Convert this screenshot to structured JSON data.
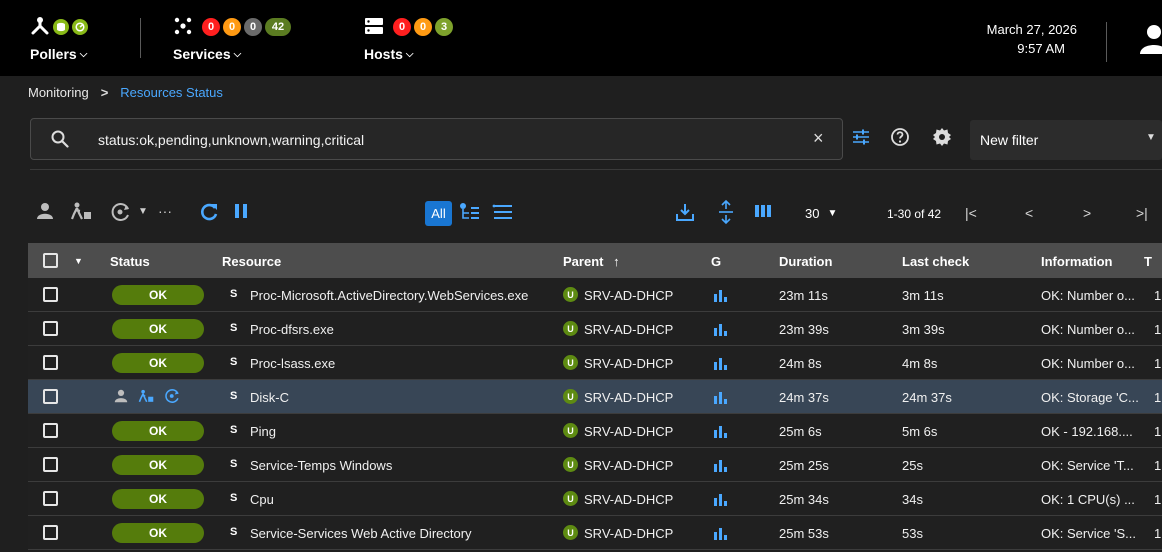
{
  "header": {
    "pollers": {
      "label": "Pollers"
    },
    "services": {
      "label": "Services",
      "counts": [
        "0",
        "0",
        "0",
        "42"
      ]
    },
    "hosts": {
      "label": "Hosts",
      "counts": [
        "0",
        "0",
        "3"
      ]
    },
    "date": "March 27, 2026",
    "time": "9:57 AM"
  },
  "breadcrumb": {
    "root": "Monitoring",
    "separator": ">",
    "current": "Resources Status"
  },
  "search": {
    "value": "status:ok,pending,unknown,warning,critical",
    "clear": "×"
  },
  "filter": {
    "selected": "New filter"
  },
  "toolbar": {
    "more": "···",
    "all_label": "All",
    "per_page": "30",
    "range": "1-30 of 42"
  },
  "table": {
    "headers": {
      "status": "Status",
      "resource": "Resource",
      "parent": "Parent",
      "graph": "G",
      "duration": "Duration",
      "last_check": "Last check",
      "information": "Information",
      "extra": "T"
    },
    "rows": [
      {
        "status": "OK",
        "type": "S",
        "resource": "Proc-Microsoft.ActiveDirectory.WebServices.exe",
        "parent_type": "U",
        "parent": "SRV-AD-DHCP",
        "duration": "23m 11s",
        "last_check": "3m 11s",
        "information": "OK: Number o...",
        "extra": "1"
      },
      {
        "status": "OK",
        "type": "S",
        "resource": "Proc-dfsrs.exe",
        "parent_type": "U",
        "parent": "SRV-AD-DHCP",
        "duration": "23m 39s",
        "last_check": "3m 39s",
        "information": "OK: Number o...",
        "extra": "1"
      },
      {
        "status": "OK",
        "type": "S",
        "resource": "Proc-lsass.exe",
        "parent_type": "U",
        "parent": "SRV-AD-DHCP",
        "duration": "24m 8s",
        "last_check": "4m 8s",
        "information": "OK: Number o...",
        "extra": "1"
      },
      {
        "status": "",
        "type": "S",
        "resource": "Disk-C",
        "parent_type": "U",
        "parent": "SRV-AD-DHCP",
        "duration": "24m 37s",
        "last_check": "24m 37s",
        "information": "OK: Storage 'C...",
        "extra": "1"
      },
      {
        "status": "OK",
        "type": "S",
        "resource": "Ping",
        "parent_type": "U",
        "parent": "SRV-AD-DHCP",
        "duration": "25m 6s",
        "last_check": "5m 6s",
        "information": "OK - 192.168....",
        "extra": "1"
      },
      {
        "status": "OK",
        "type": "S",
        "resource": "Service-Temps Windows",
        "parent_type": "U",
        "parent": "SRV-AD-DHCP",
        "duration": "25m 25s",
        "last_check": "25s",
        "information": "OK: Service 'T...",
        "extra": "1"
      },
      {
        "status": "OK",
        "type": "S",
        "resource": "Cpu",
        "parent_type": "U",
        "parent": "SRV-AD-DHCP",
        "duration": "25m 34s",
        "last_check": "34s",
        "information": "OK: 1 CPU(s) ...",
        "extra": "1"
      },
      {
        "status": "OK",
        "type": "S",
        "resource": "Service-Services Web Active Directory",
        "parent_type": "U",
        "parent": "SRV-AD-DHCP",
        "duration": "25m 53s",
        "last_check": "53s",
        "information": "OK: Service 'S...",
        "extra": "1"
      }
    ]
  },
  "colors": {
    "accent": "#1976d2",
    "ok": "#557c0c",
    "critical": "#ff1f1f",
    "warning": "#ff9a13",
    "selected_row": "#384656"
  }
}
